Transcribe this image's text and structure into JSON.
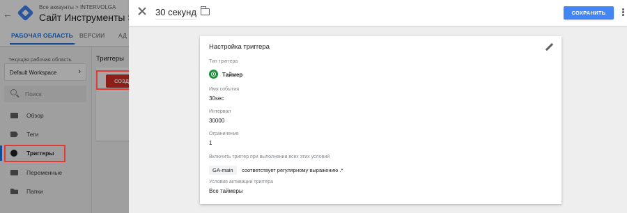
{
  "background_app": {
    "account_crumb": "Все аккаунты > INTERVOLGA",
    "container_title": "Сайт Инструменты SE",
    "tabs": [
      {
        "label": "РАБОЧАЯ ОБЛАСТЬ"
      },
      {
        "label": "ВЕРСИИ"
      },
      {
        "label": "АД"
      }
    ],
    "workspace": {
      "label": "Текущая рабочая область",
      "value": "Default Workspace"
    },
    "search": {
      "placeholder": "Поиск"
    },
    "nav_items": [
      {
        "label": "Обзор",
        "icon": "overview-icon"
      },
      {
        "label": "Теги",
        "icon": "tag-icon"
      },
      {
        "label": "Триггеры",
        "icon": "triggers-icon",
        "active": true
      },
      {
        "label": "Переменные",
        "icon": "variables-icon"
      },
      {
        "label": "Папки",
        "icon": "folder-icon"
      }
    ],
    "main": {
      "heading": "Триггеры",
      "create_label": "СОЗДАТЬ"
    },
    "accent_color": "#1a73e8",
    "create_color": "#d93025"
  },
  "overlay": {
    "trigger_name": "30 секунд",
    "save_label": "СОХРАНИТЬ",
    "save_color": "#4285f4",
    "card": {
      "title": "Настройка триггера",
      "type_label": "Тип триггера",
      "type_value": "Таймер",
      "event_name_label": "Имя события",
      "event_name_value": "30sec",
      "interval_label": "Интервал",
      "interval_value": "30000",
      "limit_label": "Ограничение",
      "limit_value": "1",
      "conditions_label": "Включить триггер при выполнении всех этих условий",
      "condition_variable": "GA-main",
      "condition_text": "соответствует регулярному выражению .*",
      "activation_label": "Условия активации триггера",
      "activation_value": "Все таймеры"
    }
  }
}
